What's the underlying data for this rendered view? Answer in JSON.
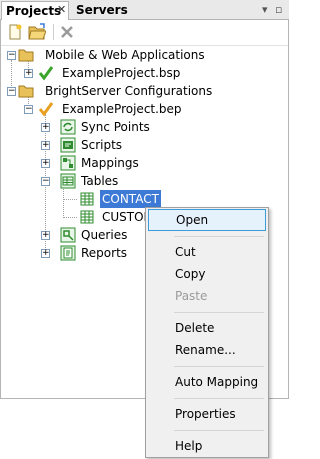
{
  "tabs": [
    {
      "label": "Projects",
      "active": true
    },
    {
      "label": "Servers",
      "active": false
    }
  ],
  "tab_close_glyph": "✕",
  "panel_controls": {
    "minimize": "▾",
    "maximize": "▫"
  },
  "toolbar": {
    "icons": [
      "new-file-icon",
      "open-folder-icon",
      "delete-x-icon"
    ]
  },
  "tree": [
    {
      "label": "Mobile & Web Applications",
      "icon": "folder-icon"
    },
    {
      "label": "ExampleProject.bsp",
      "icon": "green-check-project-icon"
    },
    {
      "label": "BrightServer Configurations",
      "icon": "folder-icon"
    },
    {
      "label": "ExampleProject.bep",
      "icon": "orange-check-project-icon"
    },
    {
      "label": "Sync Points",
      "icon": "sync-points-icon"
    },
    {
      "label": "Scripts",
      "icon": "scripts-icon"
    },
    {
      "label": "Mappings",
      "icon": "mappings-icon"
    },
    {
      "label": "Tables",
      "icon": "tables-icon"
    },
    {
      "label": "CONTACT",
      "icon": "table-icon"
    },
    {
      "label": "CUSTOM",
      "icon": "table-icon"
    },
    {
      "label": "Queries",
      "icon": "queries-icon"
    },
    {
      "label": "Reports",
      "icon": "reports-icon"
    }
  ],
  "context_menu": {
    "items": [
      {
        "label": "Open",
        "state": "hover"
      },
      {
        "label": "Cut"
      },
      {
        "label": "Copy"
      },
      {
        "label": "Paste",
        "state": "disabled"
      },
      {
        "label": "Delete"
      },
      {
        "label": "Rename..."
      },
      {
        "label": "Auto Mapping"
      },
      {
        "label": "Properties"
      },
      {
        "label": "Help"
      }
    ]
  },
  "colors": {
    "selection": "#3d7ad6",
    "menu_hover": "#e5f1fb",
    "menu_hover_border": "#3d9bdb",
    "folder": "#e8c15a",
    "green_check": "#3aa52a",
    "orange_check": "#e8a020",
    "table_green": "#2e8b2e"
  }
}
